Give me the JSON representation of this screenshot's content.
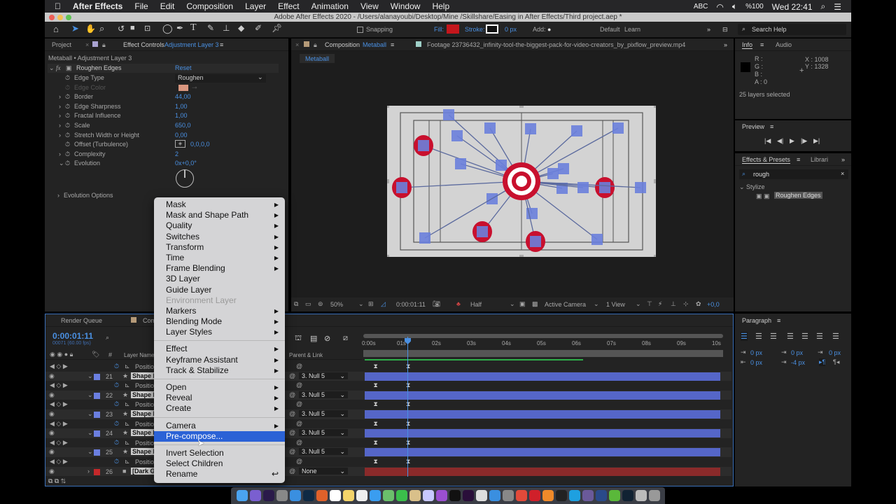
{
  "menubar": {
    "app": "After Effects",
    "items": [
      "File",
      "Edit",
      "Composition",
      "Layer",
      "Effect",
      "Animation",
      "View",
      "Window",
      "Help"
    ],
    "status": {
      "input": "ABC",
      "battery": "%100",
      "clock": "Wed 22:41"
    }
  },
  "titlebar": {
    "title": "Adobe After Effects 2020 - /Users/alanayoubi/Desktop/Mine /Skillshare/Easing in After Effects/Third project.aep *"
  },
  "toolbar": {
    "snapping": "Snapping",
    "fill": "Fill:",
    "stroke": "Stroke:",
    "stroke_width": "0 px",
    "add": "Add:",
    "workspace_default": "Default",
    "workspace_learn": "Learn",
    "search_placeholder": "Search Help",
    "fill_color": "#c4161c"
  },
  "left_panel": {
    "tab_project": "Project",
    "tab_effect_controls": "Effect Controls",
    "tab_effect_target": "Adjustment Layer 3",
    "breadcrumb": "Metaball • Adjustment Layer 3",
    "effect": {
      "name": "Roughen Edges",
      "reset": "Reset",
      "edge_color": "#d9967f",
      "properties": [
        {
          "label": "Edge Type",
          "value": "Roughen",
          "kind": "dropdown"
        },
        {
          "label": "Edge Color",
          "value": "",
          "kind": "color",
          "disabled": true
        },
        {
          "label": "Border",
          "value": "44,00"
        },
        {
          "label": "Edge Sharpness",
          "value": "1,00"
        },
        {
          "label": "Fractal Influence",
          "value": "1,00"
        },
        {
          "label": "Scale",
          "value": "650,0"
        },
        {
          "label": "Stretch Width or Height",
          "value": "0,00"
        },
        {
          "label": "Offset (Turbulence)",
          "value": "0,0,0,0"
        },
        {
          "label": "Complexity",
          "value": "2"
        },
        {
          "label": "Evolution",
          "value": "0x+0,0°"
        }
      ],
      "evolution_options": "Evolution Options"
    }
  },
  "comp_panel": {
    "tab_comp": "Composition",
    "tab_comp_name": "Metaball",
    "tab_footage": "Footage 23736432_infinity-tool-the-biggest-pack-for-video-creators_by_pixflow_preview.mp4",
    "comp_chip": "Metaball",
    "footer": {
      "zoom": "50%",
      "timecode": "0:00:01:11",
      "resolution": "Half",
      "camera": "Active Camera",
      "views": "1 View",
      "exposure": "+0,0"
    }
  },
  "info_panel": {
    "tab_info": "Info",
    "tab_audio": "Audio",
    "r": "R :",
    "g": "G :",
    "b": "B :",
    "a": "A : 0",
    "x": "X : 1008",
    "y": "Y : 1328",
    "status": "25 layers selected"
  },
  "preview_panel": {
    "title": "Preview"
  },
  "effects_panel": {
    "tab": "Effects & Presets",
    "tab_libraries": "Librari",
    "search": "rough",
    "category": "Stylize",
    "result": "Roughen Edges"
  },
  "paragraph_panel": {
    "title": "Paragraph",
    "values": [
      "0 px",
      "0 px",
      "0 px",
      "0 px",
      "-4 px"
    ]
  },
  "timeline": {
    "tab_render": "Render Queue",
    "tab_comp": "Com",
    "timecode": "0:00:01:11",
    "frames": "00071 (60.00 fps)",
    "col_layer_name": "Layer Name",
    "col_parent": "Parent & Link",
    "ruler": [
      "0:00s",
      "01s",
      "02s",
      "03s",
      "04s",
      "05s",
      "06s",
      "07s",
      "08s",
      "09s",
      "10s"
    ],
    "playhead_seconds": 1.18,
    "work_area_end_seconds": 6.2,
    "rows": [
      {
        "type": "prop",
        "label": "Position"
      },
      {
        "type": "layer",
        "num": "21",
        "name": "Shape L",
        "parent": "3. Null 5",
        "color": "#6b7fe0"
      },
      {
        "type": "prop",
        "label": "Position"
      },
      {
        "type": "layer",
        "num": "22",
        "name": "Shape L",
        "parent": "3. Null 5",
        "color": "#6b7fe0"
      },
      {
        "type": "prop",
        "label": "Position"
      },
      {
        "type": "layer",
        "num": "23",
        "name": "Shape L",
        "parent": "3. Null 5",
        "color": "#6b7fe0"
      },
      {
        "type": "prop",
        "label": "Position"
      },
      {
        "type": "layer",
        "num": "24",
        "name": "Shape L",
        "parent": "3. Null 5",
        "color": "#6b7fe0"
      },
      {
        "type": "prop",
        "label": "Position"
      },
      {
        "type": "layer",
        "num": "25",
        "name": "Shape L",
        "parent": "3. Null 5",
        "color": "#6b7fe0"
      },
      {
        "type": "prop",
        "label": "Position"
      },
      {
        "type": "layer",
        "num": "26",
        "name": "[Dark G",
        "parent": "None",
        "color": "#c4282a"
      }
    ]
  },
  "context_menu": {
    "items": [
      {
        "label": "Mask",
        "sub": true
      },
      {
        "label": "Mask and Shape Path",
        "sub": true
      },
      {
        "label": "Quality",
        "sub": true
      },
      {
        "label": "Switches",
        "sub": true
      },
      {
        "label": "Transform",
        "sub": true
      },
      {
        "label": "Time",
        "sub": true
      },
      {
        "label": "Frame Blending",
        "sub": true
      },
      {
        "label": "3D Layer"
      },
      {
        "label": "Guide Layer"
      },
      {
        "label": "Environment Layer",
        "disabled": true
      },
      {
        "label": "Markers",
        "sub": true
      },
      {
        "label": "Blending Mode",
        "sub": true
      },
      {
        "label": "Layer Styles",
        "sub": true
      },
      {
        "sep": true
      },
      {
        "label": "Effect",
        "sub": true
      },
      {
        "label": "Keyframe Assistant",
        "sub": true
      },
      {
        "label": "Track & Stabilize",
        "sub": true
      },
      {
        "sep": true
      },
      {
        "label": "Open",
        "sub": true
      },
      {
        "label": "Reveal",
        "sub": true
      },
      {
        "label": "Create",
        "sub": true
      },
      {
        "sep": true
      },
      {
        "label": "Camera",
        "sub": true
      },
      {
        "label": "Pre-compose...",
        "selected": true
      },
      {
        "sep": true
      },
      {
        "label": "Invert Selection"
      },
      {
        "label": "Select Children"
      },
      {
        "label": "Rename",
        "shortcut": "↩"
      }
    ]
  },
  "dock": {
    "apps": [
      "Finder",
      "Siri",
      "After Effects",
      "Launchpad",
      "Safari",
      "Photoshop",
      "Firefox",
      "Calendar",
      "Notes",
      "Reminders",
      "Messages",
      "Maps",
      "FaceTime",
      "Preview",
      "iTunes",
      "Podcasts",
      "TV",
      "Premiere Pro",
      "Preview 2",
      "App Store",
      "System Preferences",
      "Chrome",
      "Opera",
      "Books",
      "Piano",
      "Skype",
      "Motion",
      "Cinema 4D",
      "uTorrent",
      "Lightroom",
      "Folder",
      "Trash"
    ]
  },
  "colors": {
    "accent": "#4a90e2",
    "selection": "#2b62d6",
    "layer_bar": "#5566c8",
    "work_area": "#2fae4a"
  }
}
